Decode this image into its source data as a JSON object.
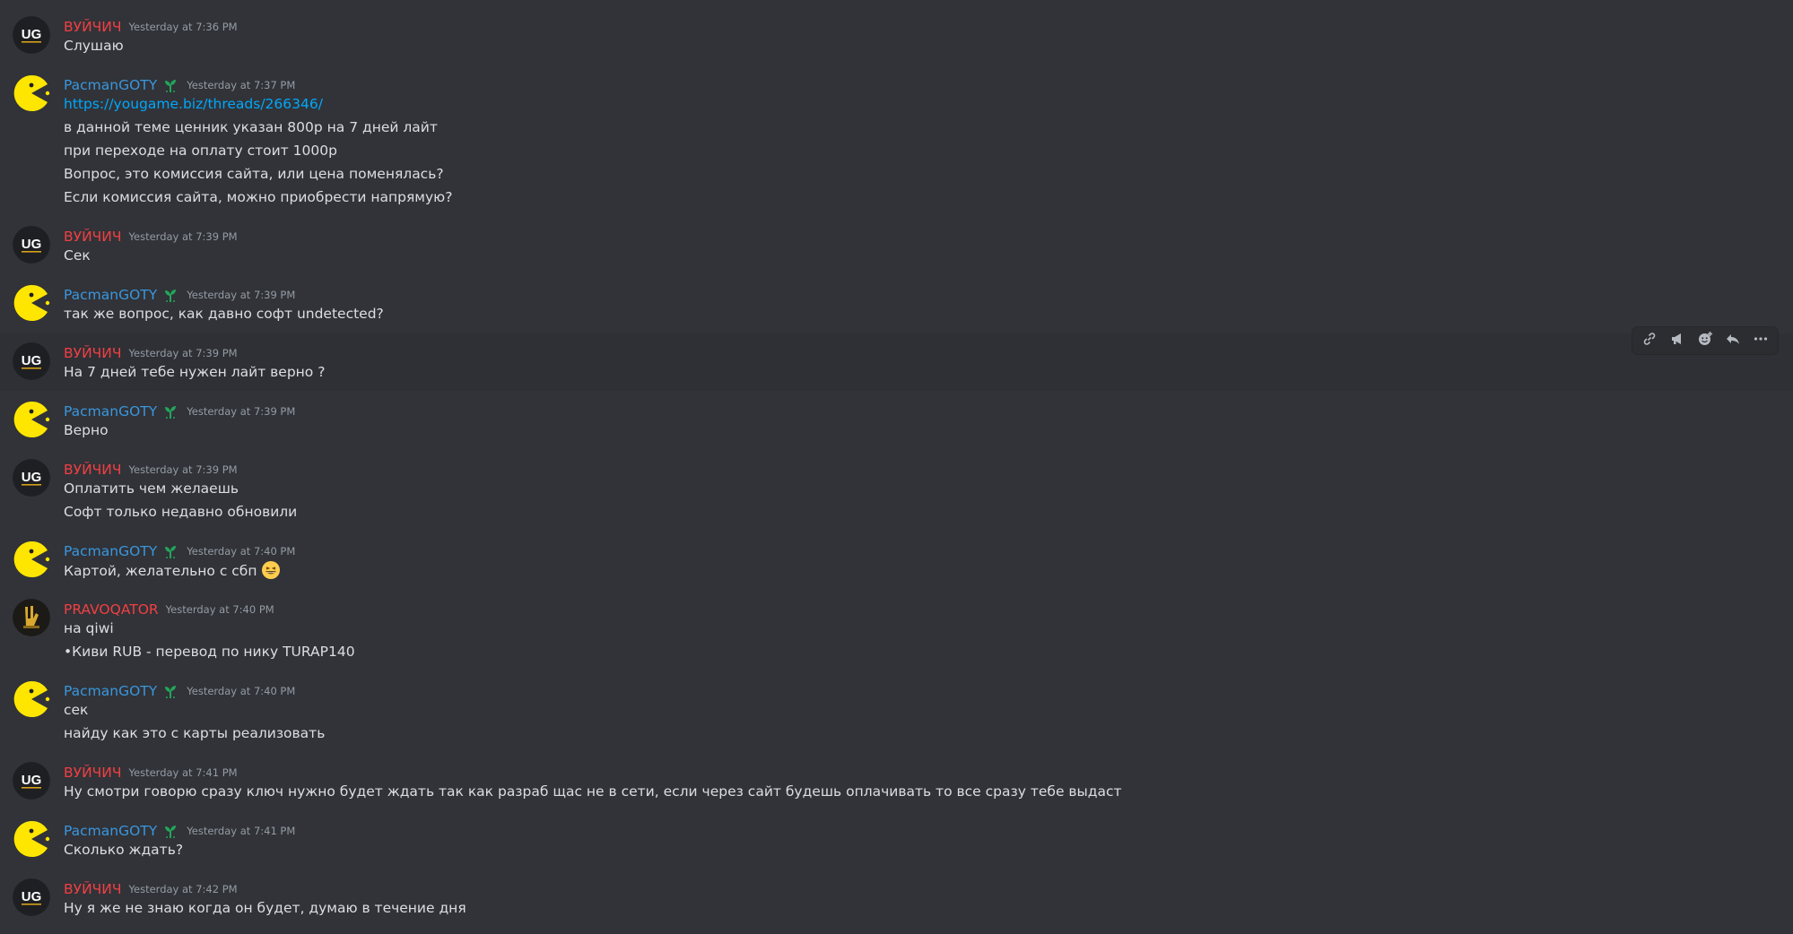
{
  "colors": {
    "background": "#313338",
    "hover_background": "#2e3035",
    "username_red": "#f23f43",
    "username_blue": "#3a96dd",
    "timestamp": "#949ba4",
    "text": "#dbdee1",
    "link": "#00a8fc",
    "badge_green": "#23a55a",
    "pacman_yellow": "#ffe600"
  },
  "messages": [
    {
      "author": "ВУЙЧИЧ",
      "timestamp": "Yesterday at 7:36 PM",
      "lines": [
        "Слушаю"
      ]
    },
    {
      "author": "PacmanGOTY",
      "timestamp": "Yesterday at 7:37 PM",
      "link": "https://yougame.biz/threads/266346/",
      "lines": [
        "в данной теме ценник указан 800р на 7 дней лайт",
        "при переходе на оплату стоит 1000р",
        "Вопрос, это комиссия сайта, или цена поменялась?",
        "Если комиссия сайта, можно приобрести напрямую?"
      ]
    },
    {
      "author": "ВУЙЧИЧ",
      "timestamp": "Yesterday at 7:39 PM",
      "lines": [
        "Сек"
      ]
    },
    {
      "author": "PacmanGOTY",
      "timestamp": "Yesterday at 7:39 PM",
      "lines": [
        "так же вопрос, как давно софт undetected?"
      ]
    },
    {
      "author": "ВУЙЧИЧ",
      "timestamp": "Yesterday at 7:39 PM",
      "lines": [
        "На 7 дней тебе нужен лайт верно ?"
      ]
    },
    {
      "author": "PacmanGOTY",
      "timestamp": "Yesterday at 7:39 PM",
      "lines": [
        "Верно"
      ]
    },
    {
      "author": "ВУЙЧИЧ",
      "timestamp": "Yesterday at 7:39 PM",
      "lines": [
        "Оплатить чем желаешь",
        "Софт только недавно обновили"
      ]
    },
    {
      "author": "PacmanGOTY",
      "timestamp": "Yesterday at 7:40 PM",
      "lines": [
        "Картой, желательно с сбп"
      ],
      "emoji": "grinning-face"
    },
    {
      "author": "PRAVOQATOR",
      "timestamp": "Yesterday at 7:40 PM",
      "lines": [
        "на qiwi",
        "•Киви RUB -  перевод по нику TURAP140"
      ]
    },
    {
      "author": "PacmanGOTY",
      "timestamp": "Yesterday at 7:40 PM",
      "lines": [
        "сек",
        "найду как это с карты реализовать"
      ]
    },
    {
      "author": "ВУЙЧИЧ",
      "timestamp": "Yesterday at 7:41 PM",
      "lines": [
        "Ну смотри говорю сразу ключ нужно будет ждать так как разраб щас не в сети, если через сайт будешь оплачивать то все сразу тебе выдаст"
      ]
    },
    {
      "author": "PacmanGOTY",
      "timestamp": "Yesterday at 7:41 PM",
      "lines": [
        "Сколько ждать?"
      ]
    },
    {
      "author": "ВУЙЧИЧ",
      "timestamp": "Yesterday at 7:42 PM",
      "lines": [
        "Ну я же не знаю когда он будет, думаю в течение дня"
      ]
    }
  ],
  "toolbar": {
    "icons": [
      "link-icon",
      "megaphone-icon",
      "add-reaction-icon",
      "reply-icon",
      "more-icon"
    ]
  }
}
